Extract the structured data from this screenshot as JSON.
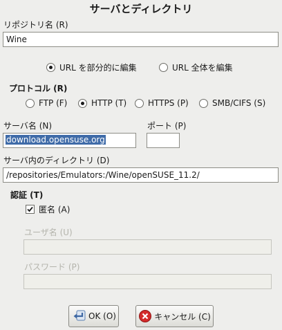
{
  "dialog": {
    "title": "サーバとディレクトリ"
  },
  "repository": {
    "label": "リポジトリ名 (R)",
    "value": "Wine"
  },
  "edit_mode": {
    "partial_label": "URL を部分的に編集",
    "full_label": "URL 全体を編集",
    "selected": "partial"
  },
  "protocol": {
    "label": "プロトコル (R)",
    "options": [
      "FTP (F)",
      "HTTP (T)",
      "HTTPS (P)",
      "SMB/CIFS (S)"
    ],
    "selected": "HTTP (T)"
  },
  "server": {
    "label": "サーバ名 (N)",
    "value": "download.opensuse.org"
  },
  "port": {
    "label": "ポート (P)",
    "value": ""
  },
  "directory": {
    "label": "サーバ内のディレクトリ (D)",
    "value": "/repositories/Emulators:/Wine/openSUSE_11.2/"
  },
  "auth": {
    "label": "認証 (T)",
    "anonymous_label": "匿名 (A)",
    "anonymous_checked": true,
    "username_label": "ユーザ名 (U)",
    "username_value": "",
    "password_label": "パスワード (P)",
    "password_value": ""
  },
  "buttons": {
    "ok_label": "OK (O)",
    "cancel_label": "キャンセル (C)"
  },
  "colors": {
    "background": "#eeeeec",
    "selection": "#3f6ba8",
    "disabled_text": "#b4b4ac",
    "cancel_icon": "#cc2222"
  }
}
